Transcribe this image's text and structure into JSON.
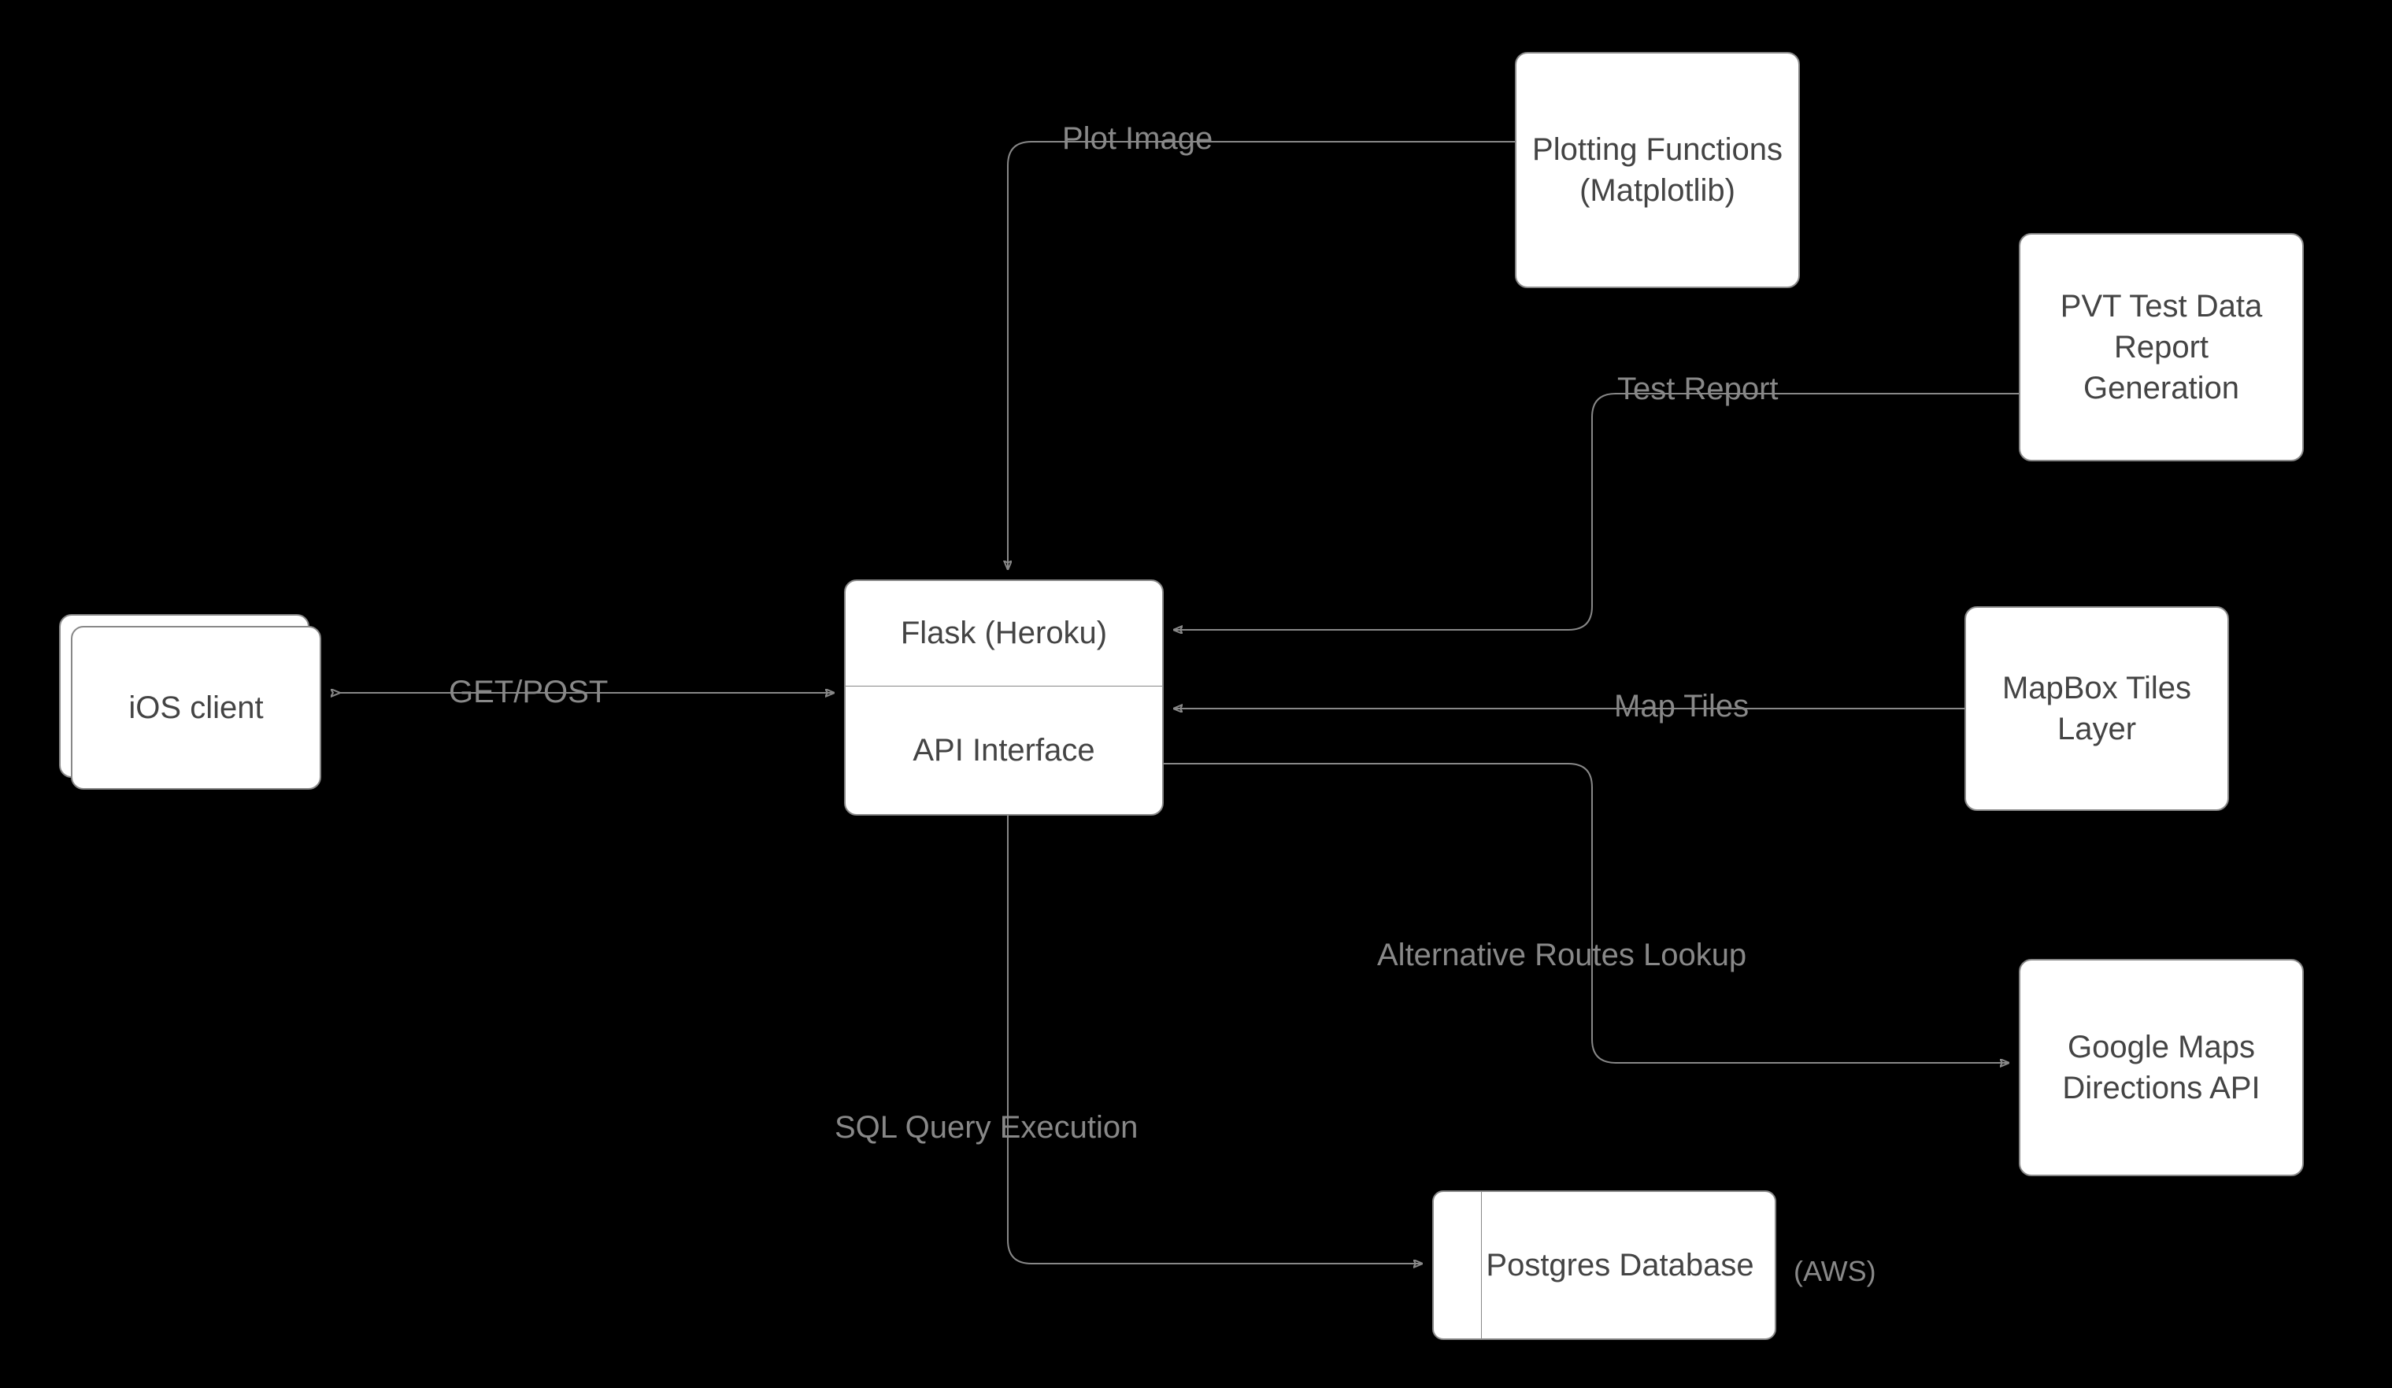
{
  "nodes": {
    "ios_client": "iOS client",
    "flask_heroku": "Flask (Heroku)",
    "api_interface": "API Interface",
    "plotting": "Plotting Functions (Matplotlib)",
    "pvt_report": "PVT Test Data Report Generation",
    "mapbox": "MapBox Tiles Layer",
    "google_maps": "Google Maps Directions API",
    "postgres": "Postgres Database",
    "postgres_annotation": "(AWS)"
  },
  "edges": {
    "get_post": "GET/POST",
    "plot_image": "Plot Image",
    "test_report": "Test Report",
    "map_tiles": "Map Tiles",
    "alt_routes": "Alternative Routes Lookup",
    "sql_query": "SQL Query Execution"
  }
}
